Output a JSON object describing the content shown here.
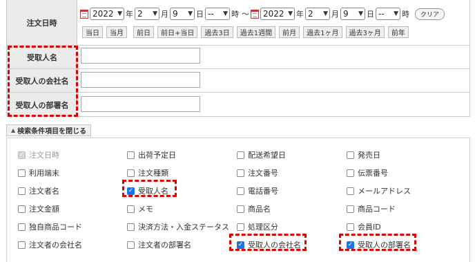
{
  "labels": {
    "order_date": "注文日時",
    "recipient_name": "受取人名",
    "recipient_company": "受取人の会社名",
    "recipient_department": "受取人の部署名"
  },
  "date_from": {
    "year": "2022",
    "month": "2",
    "day": "9",
    "hour": "--"
  },
  "date_to": {
    "year": "2022",
    "month": "2",
    "day": "9",
    "hour": "--"
  },
  "units": {
    "year": "年",
    "month": "月",
    "day": "日",
    "hour": "時",
    "range": "〜"
  },
  "clear_label": "クリア",
  "quick_buttons": [
    "当日",
    "当月",
    "前日",
    "前日+当日",
    "過去3日",
    "過去1週間",
    "前月",
    "過去1ヶ月",
    "過去3ヶ月",
    "前年"
  ],
  "fields": {
    "recipient_name": "",
    "recipient_company": "",
    "recipient_department": ""
  },
  "toggle_label": "検索条件項目を閉じる",
  "conditions": [
    {
      "label": "注文日時",
      "checked": true,
      "disabled": true
    },
    {
      "label": "出荷予定日",
      "checked": false
    },
    {
      "label": "配送希望日",
      "checked": false
    },
    {
      "label": "発売日",
      "checked": false
    },
    {
      "label": "利用端末",
      "checked": false
    },
    {
      "label": "注文種類",
      "checked": false
    },
    {
      "label": "注文番号",
      "checked": false
    },
    {
      "label": "伝票番号",
      "checked": false
    },
    {
      "label": "注文者名",
      "checked": false
    },
    {
      "label": "受取人名",
      "checked": true
    },
    {
      "label": "電話番号",
      "checked": false
    },
    {
      "label": "メールアドレス",
      "checked": false
    },
    {
      "label": "注文金額",
      "checked": false
    },
    {
      "label": "メモ",
      "checked": false
    },
    {
      "label": "商品名",
      "checked": false
    },
    {
      "label": "商品コード",
      "checked": false
    },
    {
      "label": "独自商品コード",
      "checked": false
    },
    {
      "label": "決済方法・入金ステータス",
      "checked": false
    },
    {
      "label": "処理区分",
      "checked": false
    },
    {
      "label": "会員ID",
      "checked": false
    },
    {
      "label": "注文者の会社名",
      "checked": false
    },
    {
      "label": "注文者の部署名",
      "checked": false
    },
    {
      "label": "受取人の会社名",
      "checked": true
    },
    {
      "label": "受取人の部署名",
      "checked": true
    }
  ],
  "highlight_color": "#e00000",
  "checkbox_color": "#1a73e8"
}
